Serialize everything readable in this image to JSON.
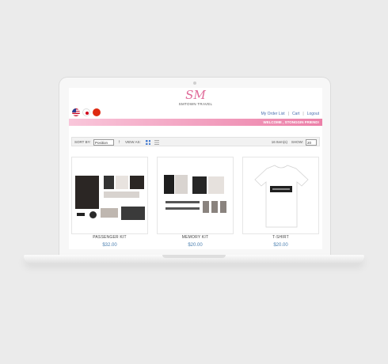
{
  "header": {
    "logo_mark": "SM",
    "logo_text": "SMTOWN TRAVEL",
    "links": {
      "my_order_list": "My Order List",
      "cart": "Cart",
      "logout": "Logout",
      "sep": "|"
    },
    "welcome": "WELCOME , STONGGIN FRIEND!"
  },
  "languages": [
    "us-flag-icon",
    "jp-flag-icon",
    "cn-flag-icon"
  ],
  "toolbar": {
    "sort_label": "SORT BY:",
    "sort_value": "Position",
    "view_label": "VIEW AS:",
    "items_count": "16 Item(s)",
    "show_label": "SHOW:",
    "show_value": "20"
  },
  "products": [
    {
      "name": "PASSENGER KIT",
      "price": "$32.00"
    },
    {
      "name": "MEMORY KIT",
      "price": "$20.00"
    },
    {
      "name": "T-SHIRT",
      "price": "$20.00"
    }
  ],
  "colors": {
    "accent_pink": "#ec7fa8",
    "link_blue": "#4a6fb0",
    "price_blue": "#4a7fb0"
  }
}
